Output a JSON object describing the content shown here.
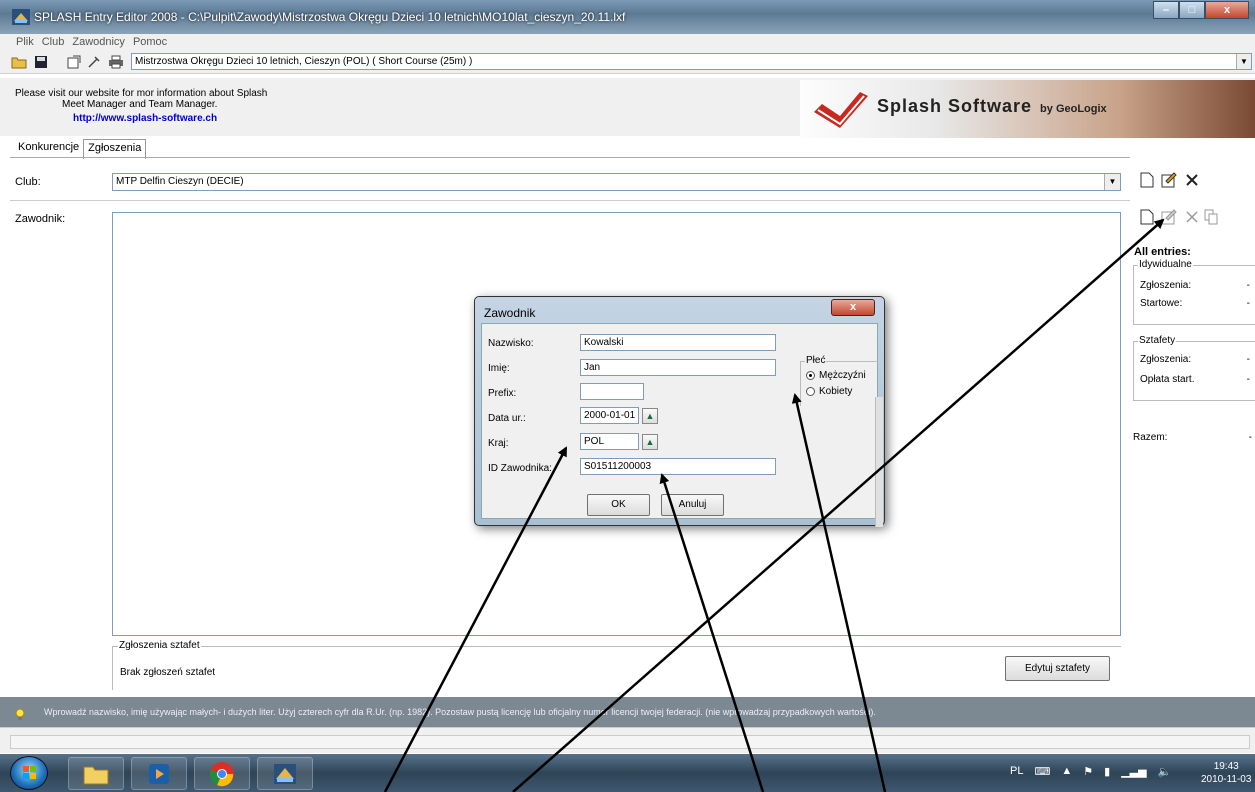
{
  "window": {
    "title": "SPLASH Entry Editor 2008 - C:\\Pulpit\\Zawody\\Mistrzostwa Okręgu Dzieci 10 letnich\\MO10lat_cieszyn_20.11.lxf",
    "buttons": {
      "minimize": "–",
      "maximize": "□",
      "close": "x"
    }
  },
  "menu": [
    "Plik",
    "Club",
    "Zawodnicy",
    "Pomoc"
  ],
  "toolbar": {
    "meet": "Mistrzostwa Okręgu Dzieci 10 letnich,  Cieszyn  (POL)  ( Short Course (25m) )"
  },
  "banner": {
    "line1": "Please visit our website for mor information about Splash",
    "line2": "Meet Manager and Team Manager.",
    "link": "http://www.splash-software.ch",
    "logo_text": "Splash Software",
    "logo_suffix": "by GeoLogix"
  },
  "tabs": [
    "Konkurencje",
    "Zgłoszenia"
  ],
  "form": {
    "club_label": "Club:",
    "club_value": "MTP Delfin Cieszyn (DECIE)",
    "athlete_label": "Zawodnik:",
    "relay_legend": "Zgłoszenia sztafet",
    "relay_none": "Brak zgłoszeń sztafet",
    "relay_button": "Edytuj sztafety"
  },
  "right_panel": {
    "title": "All entries:",
    "individual_legend": "Idywidualne",
    "relay_legend": "Sztafety",
    "entries_label": "Zgłoszenia:",
    "starts_label": "Startowe:",
    "fee_label": "Opłata start.",
    "total_label": "Razem:",
    "dash": "-"
  },
  "hint": "Wprowadź nazwisko, imię używając małych- i dużych liter. Użyj czterech cyfr dla R.Ur. (np. 1982). Pozostaw pustą licencję lub oficjalny numer licencji twojej federacji. (nie wprowadzaj przypadkowych wartości).",
  "taskbar": {
    "lang": "PL",
    "time": "19:43",
    "date": "2010-11-03"
  },
  "dialog": {
    "title": "Zawodnik",
    "close": "x",
    "fields": {
      "surname_label": "Nazwisko:",
      "surname_value": "Kowalski",
      "firstname_label": "Imię:",
      "firstname_value": "Jan",
      "prefix_label": "Prefix:",
      "prefix_value": "",
      "birth_label": "Data ur.:",
      "birth_value": "2000-01-01",
      "country_label": "Kraj:",
      "country_value": "POL",
      "id_label": "ID Zawodnika:",
      "id_value": "S01511200003"
    },
    "sex_legend": "Płeć",
    "sex_male": "Mężczyźni",
    "sex_female": "Kobiety",
    "ok": "OK",
    "cancel": "Anuluj"
  },
  "colors": {
    "link": "#0000cc",
    "hint_bar": "#7c8892",
    "dialog_frame": "#a9bfd4",
    "close_button": "#c4472e"
  }
}
